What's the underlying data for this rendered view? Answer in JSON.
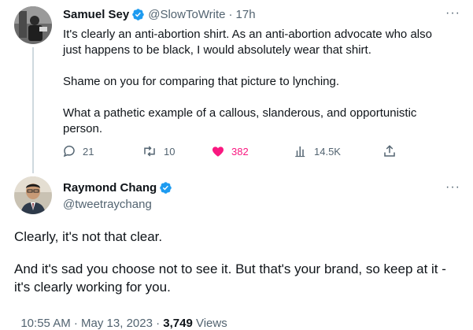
{
  "reply_tweet": {
    "author_name": "Samuel Sey",
    "handle": "@SlowToWrite",
    "separator": "·",
    "time": "17h",
    "paragraph1": "It's clearly an anti-abortion shirt. As an anti-abortion advocate who also just happens to be black, I would absolutely wear that shirt.",
    "paragraph2": "Shame on you for comparing that picture to lynching.",
    "paragraph3": "What a pathetic example of a callous, slanderous, and opportunistic person.",
    "more_icon": "more-horizontal-icon",
    "actions": {
      "replies": "21",
      "retweets": "10",
      "likes": "382",
      "views": "14.5K"
    }
  },
  "main_tweet": {
    "author_name": "Raymond Chang",
    "handle": "@tweetraychang",
    "paragraph1": "Clearly, it's not that clear.",
    "paragraph2": "And it's sad you choose not to see it. But that's your brand, so keep at it - it's clearly working for you.",
    "timestamp": "10:55 AM · May 13, 2023 · ",
    "views_count": "3,749",
    "views_label": " Views"
  },
  "colors": {
    "verified": "#1d9bf0",
    "like_active": "#f91880",
    "secondary_text": "#536471",
    "thread_line": "#cfd9de"
  }
}
